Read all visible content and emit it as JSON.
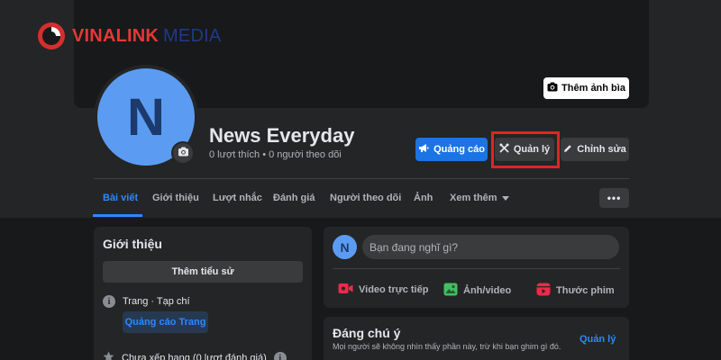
{
  "watermark": {
    "brand": "VINALINK",
    "suffix": "MEDIA",
    "logo_icon": "vinalink-logo-icon"
  },
  "cover": {
    "add_cover_label": "Thêm ảnh bìa",
    "camera_icon": "camera-icon"
  },
  "profile": {
    "avatar_letter": "N",
    "name": "News Everyday",
    "stats": "0 lượt thích • 0 người theo dõi"
  },
  "actions": {
    "ads_label": "Quảng cáo",
    "manage_label": "Quản lý",
    "edit_label": "Chỉnh sửa"
  },
  "tabs": [
    {
      "label": "Bài viết",
      "active": true
    },
    {
      "label": "Giới thiệu"
    },
    {
      "label": "Lượt nhắc"
    },
    {
      "label": "Đánh giá"
    },
    {
      "label": "Người theo dõi"
    },
    {
      "label": "Ảnh"
    },
    {
      "label": "Xem thêm"
    }
  ],
  "more_button": "•••",
  "intro": {
    "title": "Giới thiệu",
    "add_bio_label": "Thêm tiểu sử",
    "category": "Trang · Tạp chí",
    "ads_page_label": "Quảng cáo Trang",
    "rating": "Chưa xếp hạng (0 lượt đánh giá)"
  },
  "composer": {
    "avatar_letter": "N",
    "placeholder": "Bạn đang nghĩ gì?",
    "live_label": "Video trực tiếp",
    "photo_label": "Ảnh/video",
    "reel_label": "Thước phim"
  },
  "featured": {
    "title": "Đáng chú ý",
    "subtitle": "Mọi người sẽ không nhìn thấy phần này, trừ khi bạn ghim gì đó.",
    "manage_label": "Quản lý"
  },
  "colors": {
    "accent_blue": "#1b74e4",
    "highlight_red": "#e02424",
    "avatar_blue": "#5b9cf2",
    "background": "#18191a",
    "card": "#242526"
  }
}
